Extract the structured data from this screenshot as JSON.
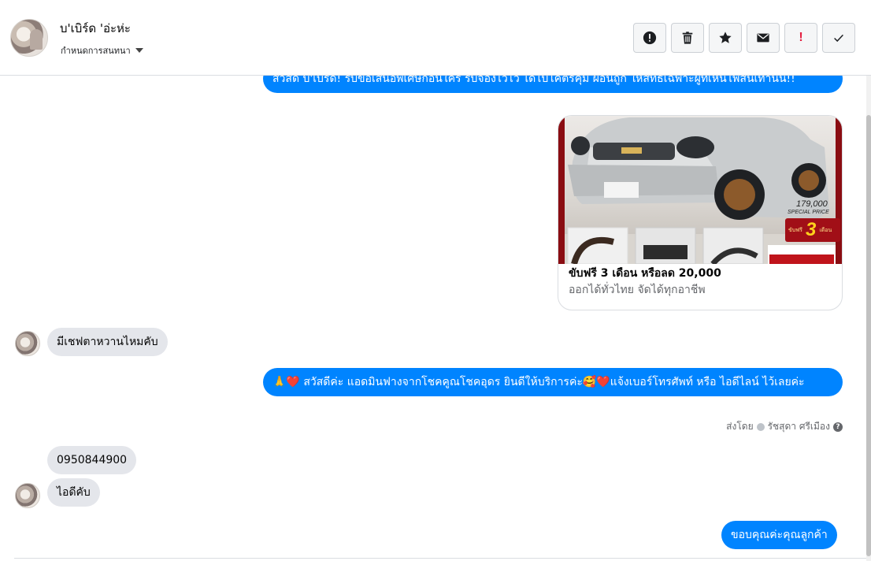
{
  "header": {
    "contact_name": "บ'เบิร์ด 'อ่ะห่ะ",
    "assign_label": "กำหนดการสนทนา",
    "actions": {
      "alert": "alert-icon",
      "delete": "trash-icon",
      "star": "star-icon",
      "mail": "mail-icon",
      "important": "!",
      "done": "check-icon"
    }
  },
  "messages": {
    "promo_text": "สวัสดี บ'เบิร์ด! รับข้อเสนอพิเศษก่อนใคร รับจองไว้ไว้ ได้ไปโคตรคุ้ม ผ่อนถูก ให้สิทธิเฉพาะผู้ที่เห็นโพสนี้เท่านั้น!!",
    "card": {
      "title": "ขับฟรี 3 เดือน หรือลด 20,000",
      "subtitle": "ออกได้ทั่วไทย จัดได้ทุกอาชีพ",
      "price": "179,000",
      "price_label": "SPECIAL PRICE",
      "months_prefix": "ขับฟรี",
      "months": "3",
      "months_suffix": "เดือน"
    },
    "in_1": "มีเชฟตาหวานไหมคับ",
    "out_2": "🙏❤️ สวัสดีค่ะ แอดมินฟางจากโชคคูณโชคอุดร ยินดีให้บริการค่ะ🥰❤️แจ้งเบอร์โทรศัพท์ หรือ ไอดีไลน์  ไว้เลยค่ะ",
    "sent_by_prefix": "ส่งโดย",
    "sent_by_name": "รัชสุดา ศรีเมือง",
    "in_2": "0950844900",
    "in_3": "ไอดีคับ",
    "out_3": "ขอบคุณค่ะคุณลูกค้า"
  },
  "colors": {
    "outgoing": "#0084ff",
    "incoming": "#e4e6eb",
    "accent_red": "#e41e3f"
  }
}
